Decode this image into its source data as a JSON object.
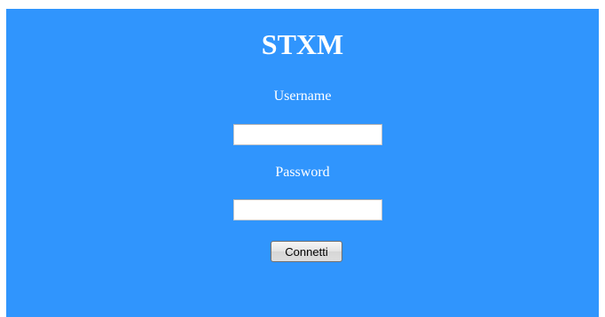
{
  "app": {
    "title": "STXM"
  },
  "form": {
    "username_label": "Username",
    "username_value": "",
    "password_label": "Password",
    "password_value": "",
    "submit_label": "Connetti"
  },
  "colors": {
    "panel_background": "#3095fd",
    "text": "#ffffff"
  }
}
